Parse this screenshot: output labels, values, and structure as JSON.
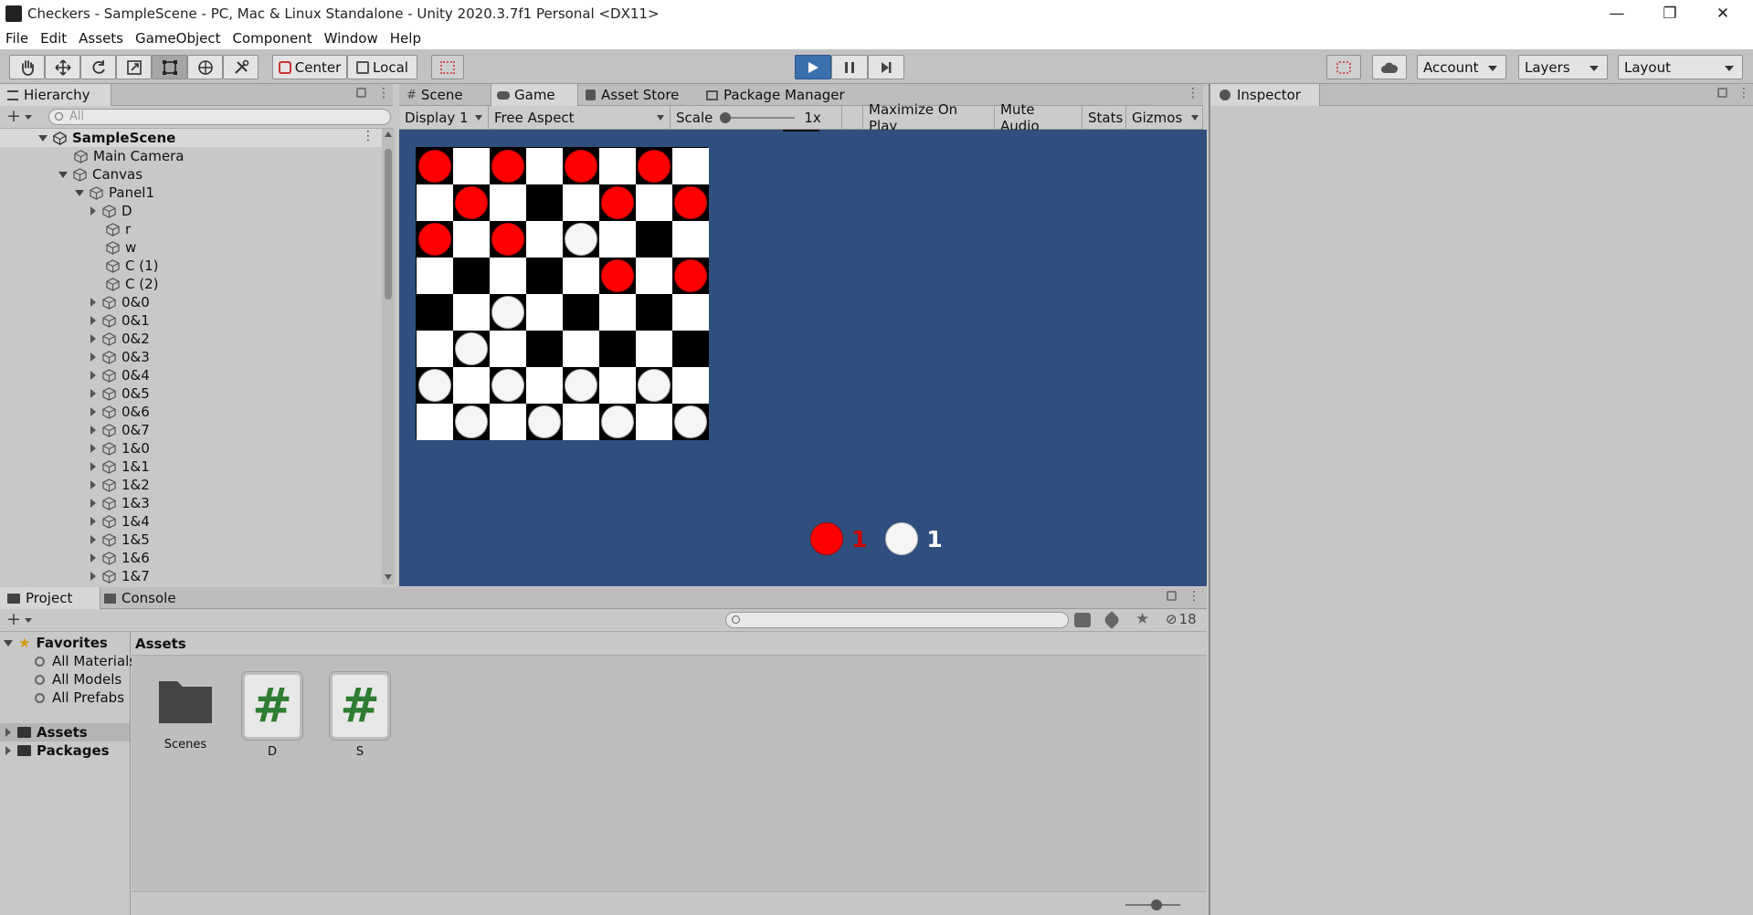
{
  "window": {
    "title": "Checkers - SampleScene - PC, Mac & Linux Standalone - Unity 2020.3.7f1 Personal <DX11>",
    "minimize": "—",
    "restore": "❐",
    "close": "✕"
  },
  "menu": [
    "File",
    "Edit",
    "Assets",
    "GameObject",
    "Component",
    "Window",
    "Help"
  ],
  "toolbar": {
    "center": "Center",
    "local": "Local",
    "account": "Account",
    "layers": "Layers",
    "layout": "Layout",
    "accent": "#3a6fb0"
  },
  "hierarchy": {
    "tab": "Hierarchy",
    "search_placeholder": "All",
    "scene": "SampleScene",
    "items": [
      {
        "label": "Main Camera",
        "depth": 1,
        "expand": "none"
      },
      {
        "label": "Canvas",
        "depth": 1,
        "expand": "open"
      },
      {
        "label": "Panel1",
        "depth": 2,
        "expand": "open"
      },
      {
        "label": "D",
        "depth": 3,
        "expand": "closed"
      },
      {
        "label": "r",
        "depth": 3,
        "expand": "none"
      },
      {
        "label": "w",
        "depth": 3,
        "expand": "none"
      },
      {
        "label": "C (1)",
        "depth": 3,
        "expand": "none"
      },
      {
        "label": "C (2)",
        "depth": 3,
        "expand": "none"
      },
      {
        "label": "0&0",
        "depth": 3,
        "expand": "closed"
      },
      {
        "label": "0&1",
        "depth": 3,
        "expand": "closed"
      },
      {
        "label": "0&2",
        "depth": 3,
        "expand": "closed"
      },
      {
        "label": "0&3",
        "depth": 3,
        "expand": "closed"
      },
      {
        "label": "0&4",
        "depth": 3,
        "expand": "closed"
      },
      {
        "label": "0&5",
        "depth": 3,
        "expand": "closed"
      },
      {
        "label": "0&6",
        "depth": 3,
        "expand": "closed"
      },
      {
        "label": "0&7",
        "depth": 3,
        "expand": "closed"
      },
      {
        "label": "1&0",
        "depth": 3,
        "expand": "closed"
      },
      {
        "label": "1&1",
        "depth": 3,
        "expand": "closed"
      },
      {
        "label": "1&2",
        "depth": 3,
        "expand": "closed"
      },
      {
        "label": "1&3",
        "depth": 3,
        "expand": "closed"
      },
      {
        "label": "1&4",
        "depth": 3,
        "expand": "closed"
      },
      {
        "label": "1&5",
        "depth": 3,
        "expand": "closed"
      },
      {
        "label": "1&6",
        "depth": 3,
        "expand": "closed"
      },
      {
        "label": "1&7",
        "depth": 3,
        "expand": "closed"
      }
    ]
  },
  "center_tabs": {
    "scene": "Scene",
    "game": "Game",
    "asset_store": "Asset Store",
    "package_manager": "Package Manager"
  },
  "game_controls": {
    "display": "Display 1",
    "aspect": "Free Aspect",
    "scale_label": "Scale",
    "scale_value": "1x",
    "maximize": "Maximize On Play",
    "mute": "Mute Audio",
    "stats": "Stats",
    "gizmos": "Gizmos"
  },
  "game": {
    "background": "#304e7e",
    "board": {
      "squares": [
        "BWBWBWBW",
        "WBWBWBWB",
        "BWBWBWBW",
        "WBWBWBWB",
        "BWBWBWBW",
        "WBWBWBWB",
        "BWBWBWBW",
        "WBWBWBWB"
      ],
      "pieces": [
        "R.R.R.R.",
        ".R...R.R",
        "R.R.W...",
        ".....R.R",
        "..W.....",
        ".W......",
        "W.W.W.W.",
        ".W.W.W.W"
      ],
      "red_color": "#ff0000",
      "white_color": "#f5f5f5"
    },
    "score": {
      "red": "1",
      "white": "1",
      "red_text_color": "#d00000",
      "white_text_color": "#ffffff"
    }
  },
  "project": {
    "project_tab": "Project",
    "console_tab": "Console",
    "hidden_count": "18",
    "favorites": "Favorites",
    "fav_items": [
      "All Materials",
      "All Models",
      "All Prefabs"
    ],
    "assets_root": "Assets",
    "packages_root": "Packages",
    "breadcrumb": "Assets",
    "assets": [
      {
        "label": "Scenes",
        "kind": "folder"
      },
      {
        "label": "D",
        "kind": "script"
      },
      {
        "label": "S",
        "kind": "script"
      }
    ]
  },
  "inspector": {
    "tab": "Inspector"
  }
}
